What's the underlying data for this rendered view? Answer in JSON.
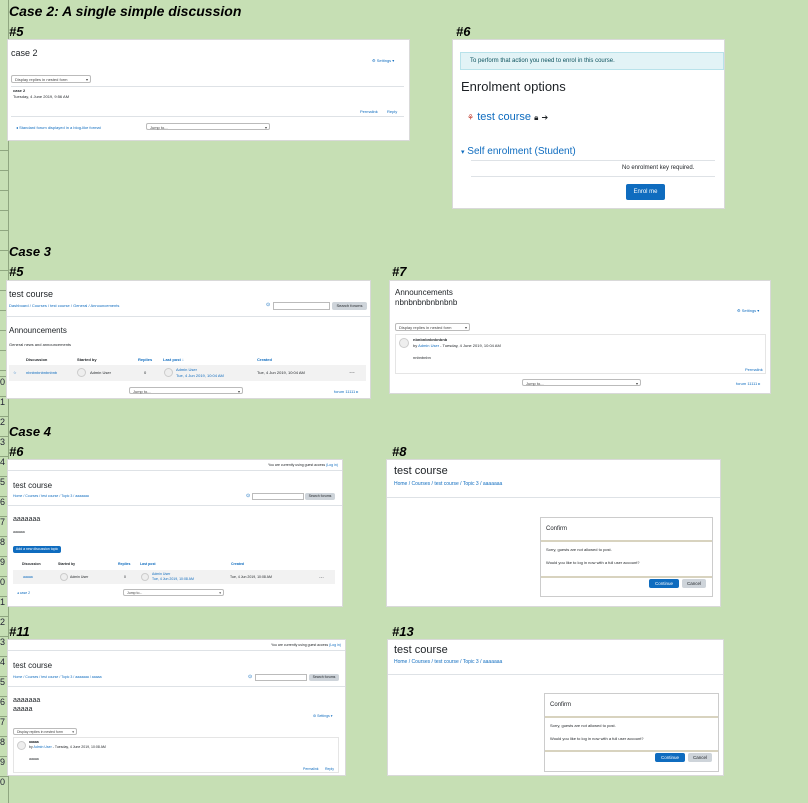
{
  "headings": {
    "case2": "Case 2: A single simple discussion",
    "case3": "Case 3",
    "case4": "Case 4",
    "p5a": "#5",
    "p6a": "#6",
    "p5b": "#5",
    "p7": "#7",
    "p6b": "#6",
    "p8": "#8",
    "p11": "#11",
    "p13": "#13"
  },
  "row_numbers": [
    "0",
    "1",
    "2",
    "3",
    "4",
    "5",
    "6",
    "7",
    "8",
    "9",
    "0",
    "1",
    "2",
    "3",
    "4",
    "5",
    "6",
    "7",
    "8",
    "9",
    "0",
    "1",
    "2",
    "3",
    "4",
    "5",
    "6",
    "7",
    "8",
    "9",
    "0"
  ],
  "p_case2_5": {
    "title": "case 2",
    "settings": "Settings",
    "display_mode": "Display replies in nested form",
    "post_subject": "case 2",
    "post_date": "Tuesday, 4 June 2019, 9:56 AM",
    "permalink": "Permalink",
    "reply": "Reply",
    "prev_link": "Standard forum displayed in a blog-like format",
    "jump_to": "Jump to..."
  },
  "p_case2_6": {
    "notice": "To perform that action you need to enrol in this course.",
    "heading": "Enrolment options",
    "course_link": "test course",
    "self_enrol": "Self enrolment (Student)",
    "no_key": "No enrolment key required.",
    "enrol_button": "Enrol me"
  },
  "p_case3_5": {
    "title": "test course",
    "breadcrumb": [
      "Dashboard",
      "Courses",
      "test course",
      "General",
      "Announcements"
    ],
    "search_button": "Search forums",
    "forum_title": "Announcements",
    "forum_desc": "General news and announcements",
    "columns": [
      "Discussion",
      "Started by",
      "Replies",
      "Last post",
      "Created"
    ],
    "row": {
      "discussion": "nbnbnbnbnbnbnb",
      "started_by": "Admin User",
      "replies": "0",
      "last_post_user": "Admin User",
      "last_post_date": "Tue, 4 Jun 2019, 10:04 AM",
      "created": "Tue, 4 Jun 2019, 10:04 AM"
    },
    "jump_to": "Jump to...",
    "next_link": "forum 11111"
  },
  "p_case3_7": {
    "title": "Announcements",
    "subtitle": "nbnbnbnbnbnbnb",
    "settings": "Settings",
    "display_mode": "Display replies in nested form",
    "post_subject": "nbnbnbnbnbnbnb",
    "post_by_prefix": "by",
    "post_author": "Admin User",
    "post_date": "- Tuesday, 4 June 2019, 10:04 AM",
    "post_body": "nnbnbnbn",
    "permalink": "Permalink",
    "jump_to": "Jump to...",
    "next_link": "forum 11111"
  },
  "p_case4_6": {
    "guest_notice": "You are currently using guest access",
    "login_link": "(Log in)",
    "title": "test course",
    "breadcrumb": [
      "Home",
      "Courses",
      "test course",
      "Topic 3",
      "aaaaaaa"
    ],
    "search_button": "Search forums",
    "forum_title": "aaaaaaa",
    "forum_desc": "aaaaaa",
    "add_button": "Add a new discussion topic",
    "columns": [
      "Discussion",
      "Started by",
      "Replies",
      "Last post",
      "Created"
    ],
    "row": {
      "discussion": "aaaaa",
      "started_by": "Admin User",
      "replies": "0",
      "last_post_user": "Admin User",
      "last_post_date": "Tue, 4 Jun 2019, 10:08 AM",
      "created": "Tue, 4 Jun 2019, 10:08 AM"
    },
    "prev_link": "case 2",
    "jump_to": "Jump to..."
  },
  "p_case4_8": {
    "title": "test course",
    "breadcrumb": [
      "Home",
      "Courses",
      "test course",
      "Topic 3",
      "aaaaaaa"
    ],
    "dialog_title": "Confirm",
    "message1": "Sorry, guests are not allowed to post.",
    "message2": "Would you like to log in now with a full user account?",
    "continue": "Continue",
    "cancel": "Cancel"
  },
  "p_case4_11": {
    "guest_notice": "You are currently using guest access",
    "login_link": "(Log in)",
    "title": "test course",
    "breadcrumb": [
      "Home",
      "Courses",
      "test course",
      "Topic 3",
      "aaaaaaa",
      "aaaaa"
    ],
    "search_button": "Search forums",
    "forum_title": "aaaaaaa",
    "subtitle": "aaaaa",
    "settings": "Settings",
    "display_mode": "Display replies in nested form",
    "post_subject": "aaaaa",
    "post_by_prefix": "by",
    "post_author": "Admin User",
    "post_date": "- Tuesday, 4 June 2019, 10:08 AM",
    "post_body": "aaaaa",
    "permalink": "Permalink",
    "reply": "Reply"
  },
  "p_case4_13": {
    "title": "test course",
    "breadcrumb": [
      "Home",
      "Courses",
      "test course",
      "Topic 3",
      "aaaaaaa"
    ],
    "dialog_title": "Confirm",
    "message1": "Sorry, guests are not allowed to post.",
    "message2": "Would you like to log in now with a full user account?",
    "continue": "Continue",
    "cancel": "Cancel"
  },
  "colors": {
    "background": "#c6dfb4",
    "link": "#0f6cbf",
    "primary_button": "#0f6cbf",
    "notice_bg": "#e2f3f6"
  },
  "icons": [
    "gear-icon",
    "chevron-down-icon",
    "lock-icon",
    "sign-in-icon",
    "course-icon",
    "search-icon",
    "sort-down-icon",
    "ellipsis-icon",
    "left-arrow-icon",
    "right-arrow-icon"
  ]
}
